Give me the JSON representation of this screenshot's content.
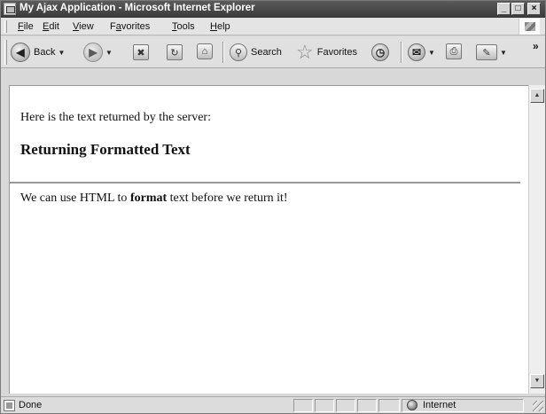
{
  "window": {
    "title": "My Ajax Application - Microsoft Internet Explorer",
    "controls": {
      "minimize": "_",
      "maximize": "□",
      "close": "×"
    }
  },
  "menubar": {
    "items": [
      {
        "prefix": "",
        "accel": "F",
        "rest": "ile"
      },
      {
        "prefix": "",
        "accel": "E",
        "rest": "dit"
      },
      {
        "prefix": "",
        "accel": "V",
        "rest": "iew"
      },
      {
        "prefix": "F",
        "accel": "a",
        "rest": "vorites"
      },
      {
        "prefix": "",
        "accel": "T",
        "rest": "ools"
      },
      {
        "prefix": "",
        "accel": "H",
        "rest": "elp"
      }
    ]
  },
  "toolbar": {
    "back_label": "Back",
    "search_label": "Search",
    "favorites_label": "Favorites",
    "icons": [
      "back-icon",
      "forward-icon",
      "stop-icon",
      "refresh-icon",
      "home-icon",
      "search-icon",
      "favorites-icon",
      "history-icon",
      "mail-icon",
      "print-icon",
      "edit-icon"
    ],
    "overflow": "»"
  },
  "page": {
    "intro": "Here is the text returned by the server:",
    "heading": "Returning Formatted Text",
    "para_before": "We can use HTML to ",
    "para_bold": "format",
    "para_after": " text before we return it!"
  },
  "statusbar": {
    "status": "Done",
    "zone": "Internet"
  }
}
